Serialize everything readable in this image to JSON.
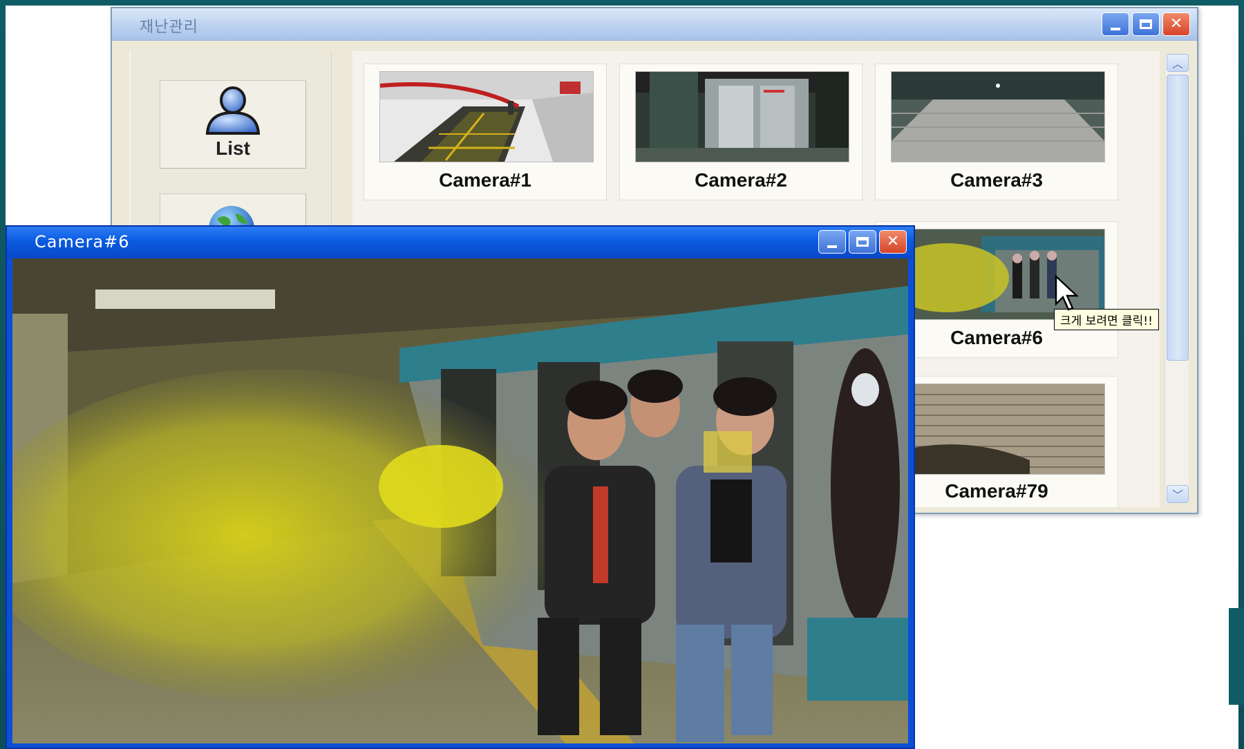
{
  "main_window": {
    "title": "재난관리",
    "sidebar": {
      "list_label": "List",
      "globe_label": ""
    },
    "cameras": [
      {
        "label": "Camera#1"
      },
      {
        "label": "Camera#2"
      },
      {
        "label": "Camera#3"
      },
      {
        "label": "Camera#6"
      },
      {
        "label": "Camera#79"
      }
    ],
    "tooltip": "크게 보려면 클릭!!"
  },
  "camera_window": {
    "title": "Camera#6"
  },
  "colors": {
    "xp_blue": "#0a4fd6",
    "close_red": "#d7442a",
    "panel_beige": "#ece9d8",
    "smoke_yellow": "#c9c325"
  },
  "icons": [
    "user-icon",
    "globe-icon",
    "minimize-icon",
    "maximize-icon",
    "close-icon",
    "scroll-up-icon",
    "scroll-down-icon",
    "cursor-icon"
  ]
}
